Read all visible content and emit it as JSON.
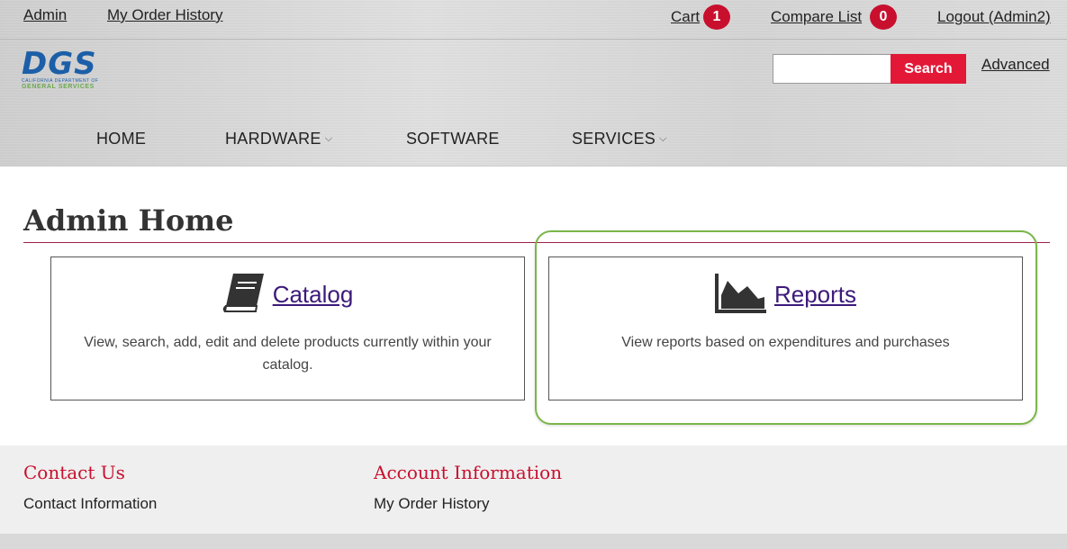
{
  "topbar": {
    "admin": "Admin",
    "order_history": "My Order History",
    "cart": "Cart",
    "cart_count": "1",
    "compare": "Compare List",
    "compare_count": "0",
    "logout": "Logout (Admin2)"
  },
  "logo": {
    "main": "DGS",
    "line1": "CALIFORNIA DEPARTMENT OF",
    "line2": "GENERAL SERVICES"
  },
  "search": {
    "value": "",
    "button": "Search",
    "advanced": "Advanced"
  },
  "nav": {
    "home": "HOME",
    "hardware": "HARDWARE",
    "software": "SOFTWARE",
    "services": "SERVICES"
  },
  "main": {
    "title": "Admin Home",
    "cards": [
      {
        "icon": "book-icon",
        "label": "Catalog",
        "desc": "View, search, add, edit and delete products currently within your catalog."
      },
      {
        "icon": "area-chart-icon",
        "label": "Reports",
        "desc": "View reports based on expenditures and purchases"
      }
    ]
  },
  "footer": {
    "contact_title": "Contact Us",
    "contact_link": "Contact Information",
    "account_title": "Account Information",
    "account_link": "My Order History"
  },
  "colors": {
    "brand_red": "#c8102e",
    "link_purple": "#3c1a7a",
    "logo_blue": "#1c5fa8",
    "highlight_green": "#7ab648"
  }
}
